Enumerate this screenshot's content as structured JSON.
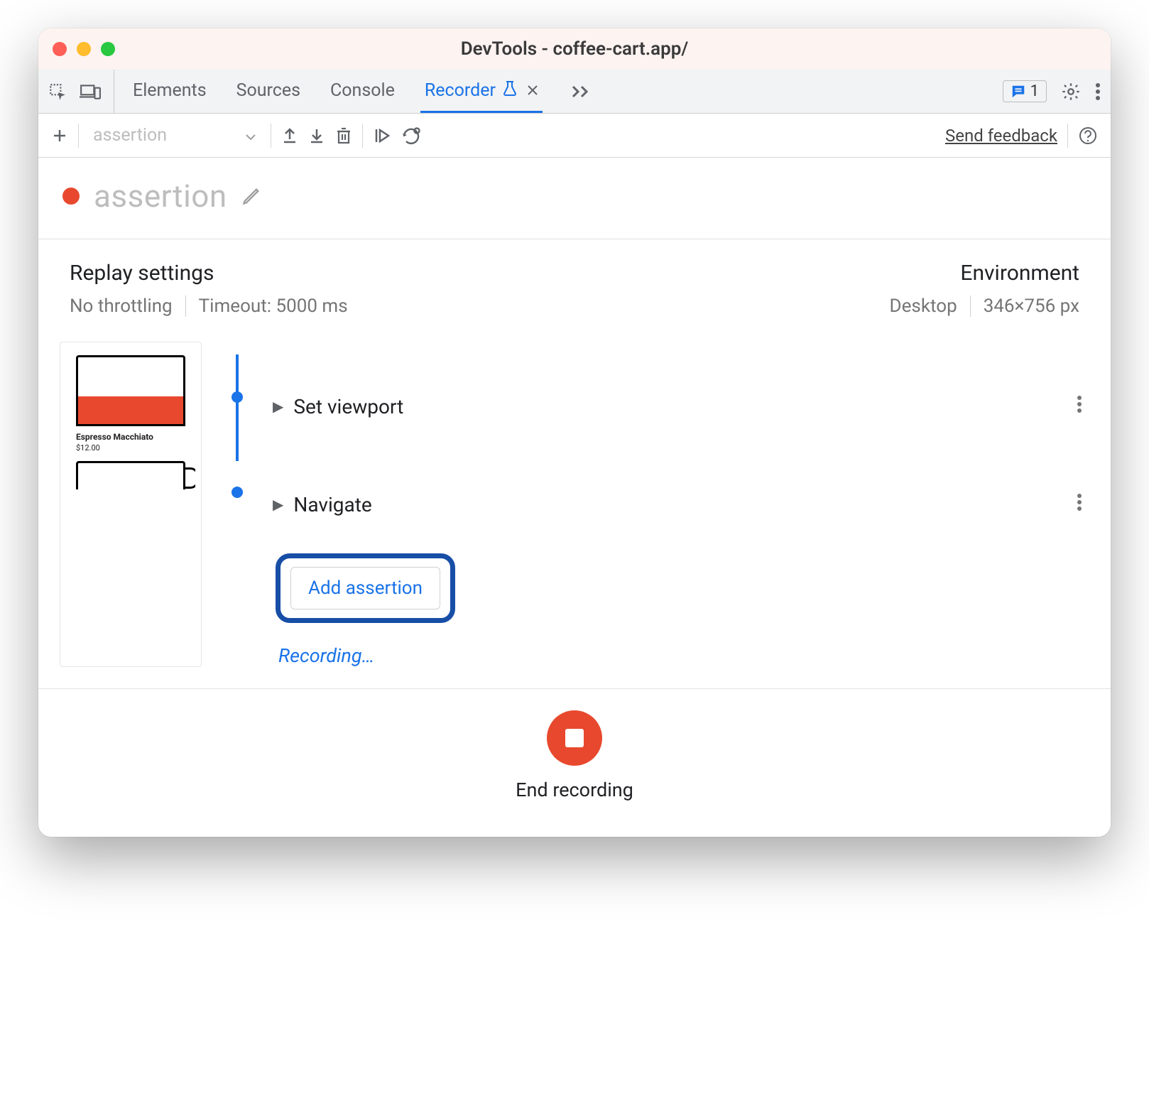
{
  "window": {
    "title": "DevTools - coffee-cart.app/"
  },
  "tabs": {
    "elements": "Elements",
    "sources": "Sources",
    "console": "Console",
    "recorder": "Recorder"
  },
  "issues_badge": "1",
  "toolbar": {
    "dropdown_value": "assertion",
    "send_feedback": "Send feedback"
  },
  "recording": {
    "title": "assertion"
  },
  "replay": {
    "heading": "Replay settings",
    "throttling": "No throttling",
    "timeout": "Timeout: 5000 ms"
  },
  "environment": {
    "heading": "Environment",
    "device": "Desktop",
    "dimensions": "346×756 px"
  },
  "thumbnail": {
    "product_name": "Espresso Macchiato",
    "price": "$12.00"
  },
  "steps": {
    "set_viewport": "Set viewport",
    "navigate": "Navigate",
    "add_assertion": "Add assertion",
    "recording": "Recording…"
  },
  "footer": {
    "end_recording": "End recording"
  }
}
